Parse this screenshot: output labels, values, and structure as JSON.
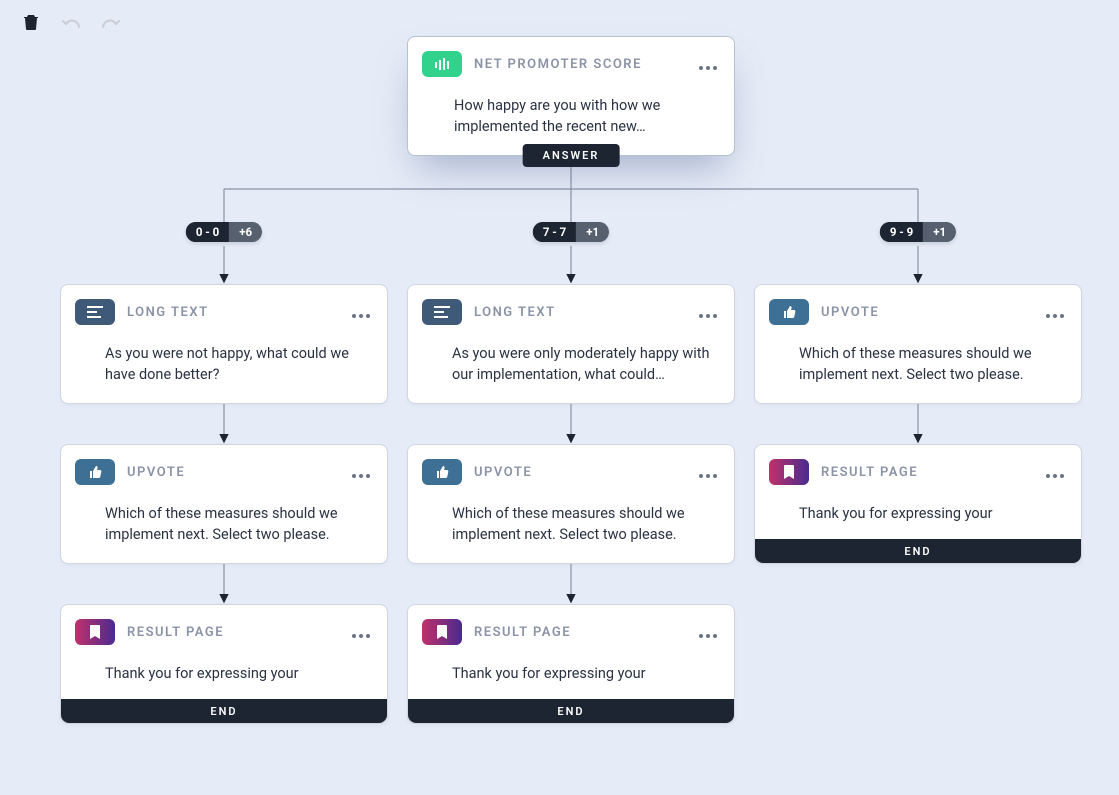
{
  "toolbar": {
    "delete_tooltip": "Delete",
    "undo_tooltip": "Undo",
    "redo_tooltip": "Redo"
  },
  "labels": {
    "answer": "ANSWER",
    "end": "END"
  },
  "types": {
    "nps": "NET PROMOTER SCORE",
    "long_text": "LONG TEXT",
    "upvote": "UPVOTE",
    "result": "RESULT PAGE"
  },
  "branches": [
    {
      "range": "0 - 0",
      "extra": "+6"
    },
    {
      "range": "7 - 7",
      "extra": "+1"
    },
    {
      "range": "9 - 9",
      "extra": "+1"
    }
  ],
  "nodes": {
    "root": {
      "type": "nps",
      "question": "How happy are you with how we implemented the recent new…"
    },
    "a1": {
      "type": "long_text",
      "text": "As you were not happy, what could we have done better?"
    },
    "a2": {
      "type": "upvote",
      "text": "Which of these measures should we implement next. Select two please."
    },
    "a3": {
      "type": "result",
      "text": "Thank you for expressing your opinion!We will notify all employees"
    },
    "b1": {
      "type": "long_text",
      "text": "As you were only moderately happy with our implementation, what could…"
    },
    "b2": {
      "type": "upvote",
      "text": "Which of these measures should we implement next. Select two please."
    },
    "b3": {
      "type": "result",
      "text": "Thank you for expressing your opinion!We will notify all employees"
    },
    "c1": {
      "type": "upvote",
      "text": "Which of these measures should we implement next. Select two please."
    },
    "c2": {
      "type": "result",
      "text": "Thank you for expressing your opinion!We will notify all employees"
    }
  }
}
